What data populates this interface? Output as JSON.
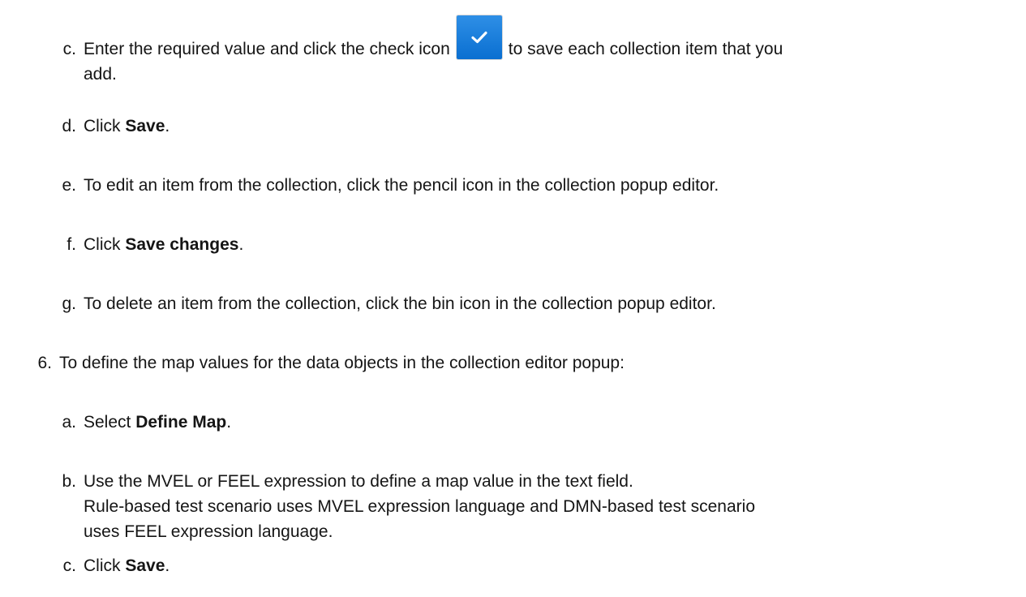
{
  "substeps_a": [
    {
      "marker": "c.",
      "before_icon": "Enter the required value and click the check icon",
      "icon": "check-icon",
      "after_icon": "to save each collection item that you",
      "line2": "add."
    },
    {
      "marker": "d.",
      "prefix": "Click ",
      "bold": "Save",
      "suffix": "."
    },
    {
      "marker": "e.",
      "text": "To edit an item from the collection, click the pencil icon in the collection popup editor."
    },
    {
      "marker": "f.",
      "prefix": "Click ",
      "bold": "Save changes",
      "suffix": "."
    },
    {
      "marker": "g.",
      "text": "To delete an item from the collection, click the bin icon in the collection popup editor."
    }
  ],
  "step6": {
    "marker": "6.",
    "text": "To define the map values for the data objects in the collection editor popup:"
  },
  "substeps_b": [
    {
      "marker": "a.",
      "prefix": "Select ",
      "bold": "Define Map",
      "suffix": "."
    },
    {
      "marker": "b.",
      "line1": "Use the MVEL or FEEL expression to define a map value in the text field.",
      "line2": "Rule-based test scenario uses MVEL expression language and DMN-based test scenario",
      "line3": "uses FEEL expression language."
    },
    {
      "marker": "c.",
      "prefix": "Click ",
      "bold": "Save",
      "suffix": "."
    }
  ],
  "colors": {
    "text": "#151515",
    "check_icon_bg": "#0a6fd1",
    "check_mark": "#ffffff"
  }
}
